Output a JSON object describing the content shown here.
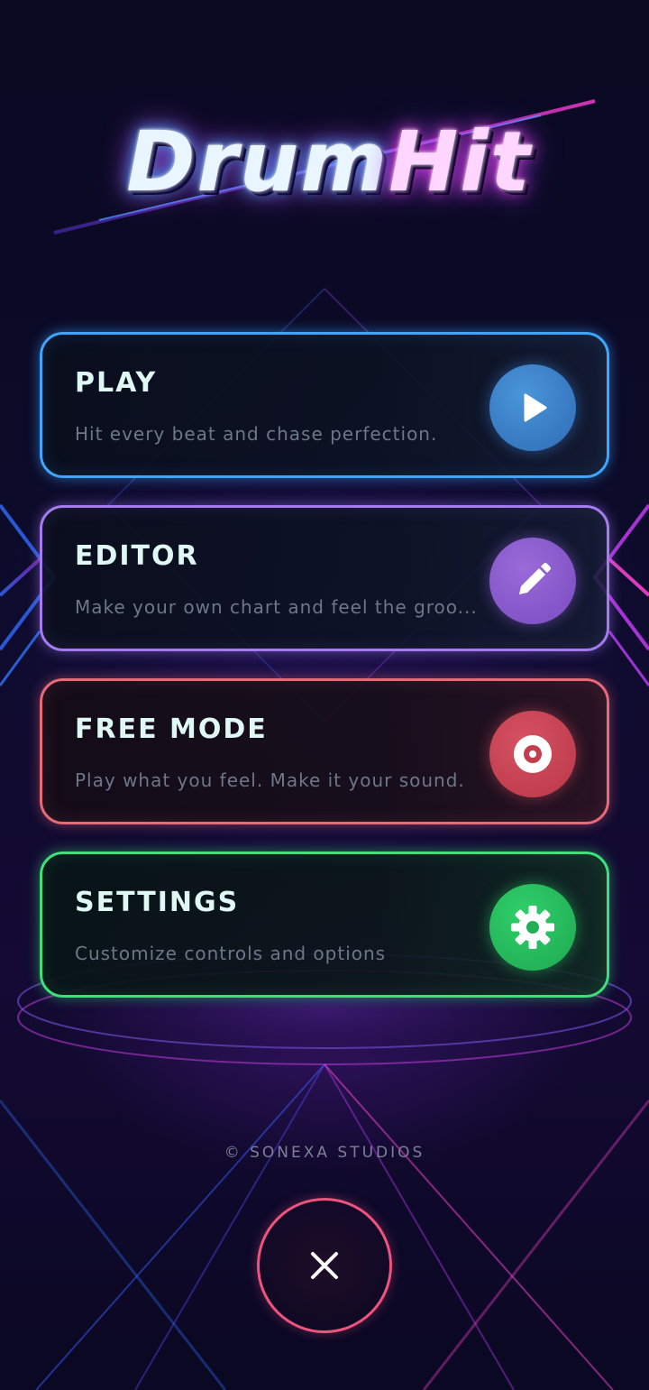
{
  "app": {
    "logo": {
      "part1": "Drum",
      "part2": "Hit"
    }
  },
  "menu": {
    "items": [
      {
        "id": "play",
        "title": "PLAY",
        "subtitle": "Hit every beat and chase perfection.",
        "icon": "play-icon",
        "accent": "#3fa6ff"
      },
      {
        "id": "editor",
        "title": "EDITOR",
        "subtitle": "Make your own chart and feel the groo...",
        "icon": "pencil-icon",
        "accent": "#a57cf0"
      },
      {
        "id": "free_mode",
        "title": "FREE MODE",
        "subtitle": "Play what you feel. Make it your sound.",
        "icon": "disc-icon",
        "accent": "#e86a78"
      },
      {
        "id": "settings",
        "title": "SETTINGS",
        "subtitle": "Customize controls and options",
        "icon": "gear-icon",
        "accent": "#3ee07a"
      }
    ]
  },
  "footer": {
    "copyright": "© SONEXA STUDIOS",
    "close_icon": "close-icon",
    "close_color": "#f0537e"
  }
}
